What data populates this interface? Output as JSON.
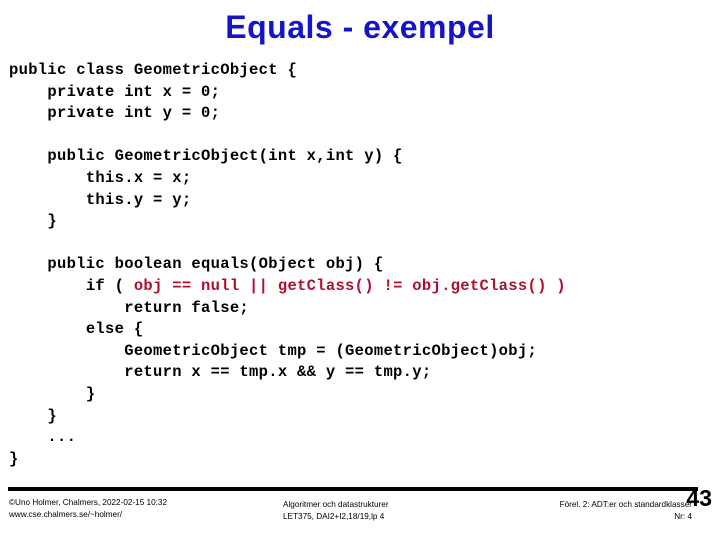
{
  "slide": {
    "title": "Equals - exempel",
    "title_color": "#1414C8"
  },
  "code": {
    "font": "monospace-bold",
    "highlight_color": "#B01030",
    "lines": [
      {
        "indent": 0,
        "segments": [
          {
            "text": "public class GeometricObject {",
            "color": "black"
          }
        ]
      },
      {
        "indent": 1,
        "segments": [
          {
            "text": "private int x = 0;",
            "color": "black"
          }
        ]
      },
      {
        "indent": 1,
        "segments": [
          {
            "text": "private int y = 0;",
            "color": "black"
          }
        ]
      },
      {
        "indent": 0,
        "segments": []
      },
      {
        "indent": 1,
        "segments": [
          {
            "text": "public GeometricObject(int x,int y) {",
            "color": "black"
          }
        ]
      },
      {
        "indent": 2,
        "segments": [
          {
            "text": "this.x = x;",
            "color": "black"
          }
        ]
      },
      {
        "indent": 2,
        "segments": [
          {
            "text": "this.y = y;",
            "color": "black"
          }
        ]
      },
      {
        "indent": 1,
        "segments": [
          {
            "text": "}",
            "color": "black"
          }
        ]
      },
      {
        "indent": 0,
        "segments": []
      },
      {
        "indent": 1,
        "segments": [
          {
            "text": "public boolean equals(Object obj) {",
            "color": "black"
          }
        ]
      },
      {
        "indent": 2,
        "segments": [
          {
            "text": "if ( ",
            "color": "black"
          },
          {
            "text": "obj == null || getClass() != obj.getClass() )",
            "color": "red"
          }
        ]
      },
      {
        "indent": 3,
        "segments": [
          {
            "text": "return false;",
            "color": "black"
          }
        ]
      },
      {
        "indent": 2,
        "segments": [
          {
            "text": "else {",
            "color": "black"
          }
        ]
      },
      {
        "indent": 3,
        "segments": [
          {
            "text": "GeometricObject tmp = (GeometricObject)obj;",
            "color": "black"
          }
        ]
      },
      {
        "indent": 3,
        "segments": [
          {
            "text": "return x == tmp.x && y == tmp.y;",
            "color": "black"
          }
        ]
      },
      {
        "indent": 2,
        "segments": [
          {
            "text": "}",
            "color": "black"
          }
        ]
      },
      {
        "indent": 1,
        "segments": [
          {
            "text": "}",
            "color": "black"
          }
        ]
      },
      {
        "indent": 1,
        "segments": [
          {
            "text": "...",
            "color": "black"
          }
        ]
      },
      {
        "indent": 0,
        "segments": [
          {
            "text": "}",
            "color": "black"
          }
        ]
      }
    ]
  },
  "footer": {
    "left_line1": "©Uno Holmer, Chalmers, 2022-02-15 10:32",
    "left_line2": "www.cse.chalmers.se/~holmer/",
    "center_line1": "Algoritmer och datastrukturer",
    "center_line2": "LET375, DAI2+I2,18/19,lp 4",
    "right_line1": "Förel. 2: ADT:er och standardklasser",
    "right_line2": "Nr: 4",
    "page_number": "43"
  }
}
